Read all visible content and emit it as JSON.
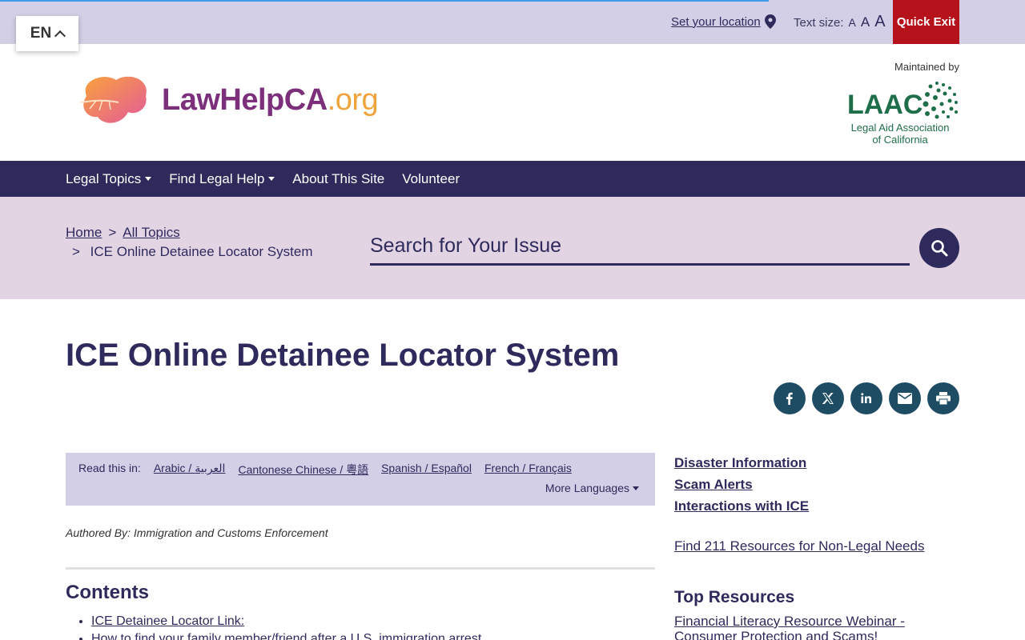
{
  "language_selector": {
    "label": "EN"
  },
  "utility": {
    "set_location": "Set your location",
    "text_size_label": "Text size:",
    "text_sizes": [
      "A",
      "A",
      "A"
    ],
    "quick_exit": "Quick Exit"
  },
  "header": {
    "logo_main": "LawHelpCA",
    "logo_suffix": ".org",
    "maintained_by": "Maintained by",
    "partner_logo_word": "LAAC",
    "partner_name_line1": "Legal Aid Association",
    "partner_name_line2": "of California"
  },
  "nav": {
    "items": [
      {
        "label": "Legal Topics",
        "dropdown": true
      },
      {
        "label": "Find Legal Help",
        "dropdown": true
      },
      {
        "label": "About This Site",
        "dropdown": false
      },
      {
        "label": "Volunteer",
        "dropdown": false
      }
    ]
  },
  "breadcrumb": {
    "home": "Home",
    "separator": ">",
    "all_topics": "All Topics",
    "current": "ICE Online Detainee Locator System"
  },
  "search": {
    "placeholder": "Search for Your Issue"
  },
  "page": {
    "title": "ICE Online Detainee Locator System",
    "authored_by": "Authored By: Immigration and Customs Enforcement"
  },
  "share": [
    "facebook",
    "x",
    "linkedin",
    "email",
    "print"
  ],
  "translation": {
    "label": "Read this in:",
    "languages": [
      "Arabic / العربية",
      "Cantonese Chinese / 粵語",
      "Spanish / Español",
      "French / Français"
    ],
    "more": "More Languages"
  },
  "contents": {
    "title": "Contents",
    "items": [
      "ICE Detainee Locator Link:",
      "How to find your family member/friend after a U.S. immigration arrest"
    ]
  },
  "sidebar": {
    "links": [
      "Disaster Information",
      "Scam Alerts",
      "Interactions with ICE"
    ],
    "resources_link": "Find 211 Resources for Non-Legal Needs",
    "top_resources_title": "Top Resources",
    "top_resources_link": "Financial Literacy Resource Webinar - Consumer Protection and Scams!"
  },
  "colors": {
    "utility_bg": "#d3cfe6",
    "nav_bg": "#2f2a5c",
    "band_bg": "#e3d4e4",
    "quick_exit_bg": "#b5121b",
    "share_bg": "#1d4c63",
    "logo_purple": "#7c2f7a",
    "logo_orange": "#f0a33a",
    "laac_green": "#1f6e4a"
  }
}
